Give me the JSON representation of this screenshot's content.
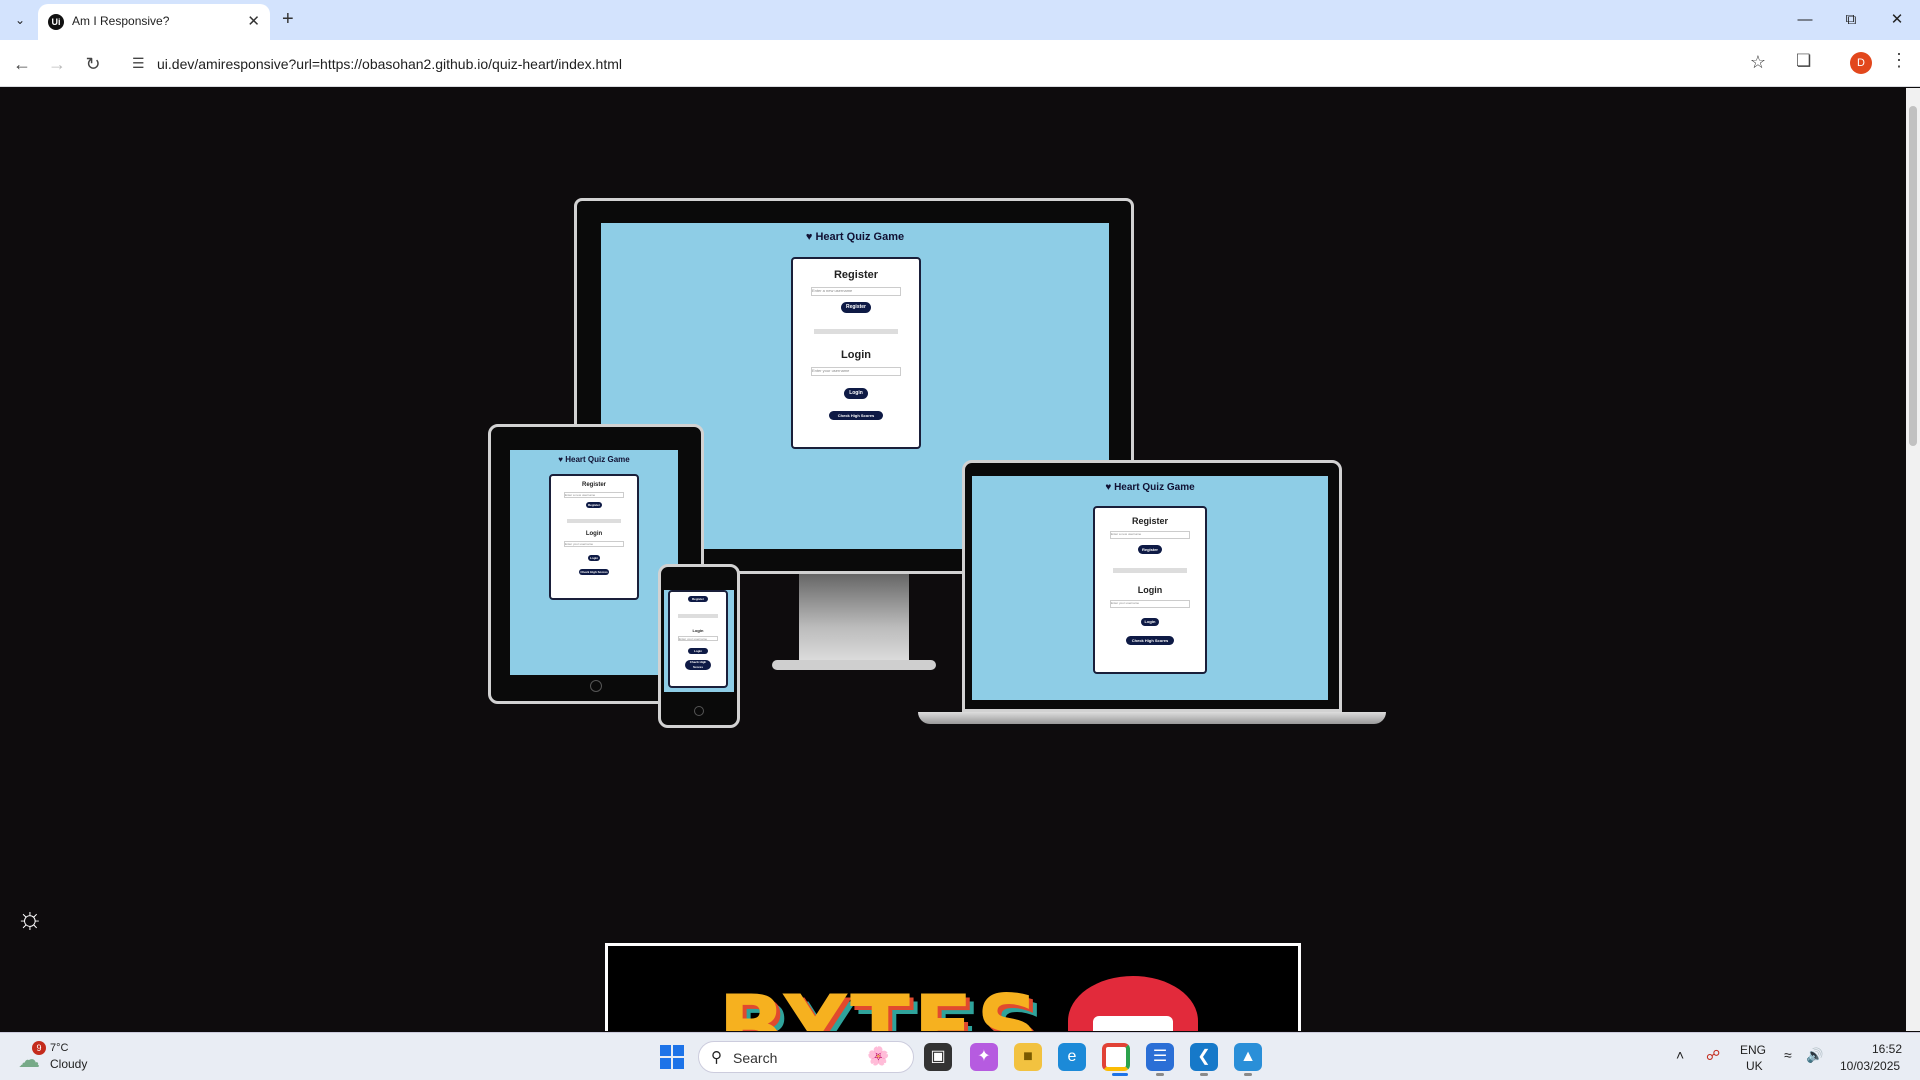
{
  "browser": {
    "tab_title": "Am I Responsive?",
    "favicon_text": "Ui",
    "url": "ui.dev/amiresponsive?url=https://obasohan2.github.io/quiz-heart/index.html",
    "profile_initial": "D"
  },
  "quiz": {
    "brand": "Heart Quiz Game",
    "register_heading": "Register",
    "register_placeholder": "Enter a new username",
    "register_button": "Register",
    "login_heading": "Login",
    "login_placeholder": "Enter your username",
    "login_button": "Login",
    "highscores_button": "Check High Scores"
  },
  "below_fold_banner": {
    "text": "BYTES"
  },
  "taskbar": {
    "weather_badge": "9",
    "temperature": "7°C",
    "condition": "Cloudy",
    "search_label": "Search",
    "language": "ENG",
    "region": "UK",
    "time": "16:52",
    "date": "10/03/2025"
  },
  "icons": {
    "theme_toggle": "sun-icon",
    "start": "windows-start-icon"
  },
  "colors": {
    "page_background": "#0e0c0d",
    "quiz_screen": "#8ecde6",
    "quiz_button": "#0e1a45",
    "tab_strip": "#d3e3fd",
    "profile_avatar": "#e2471c"
  }
}
